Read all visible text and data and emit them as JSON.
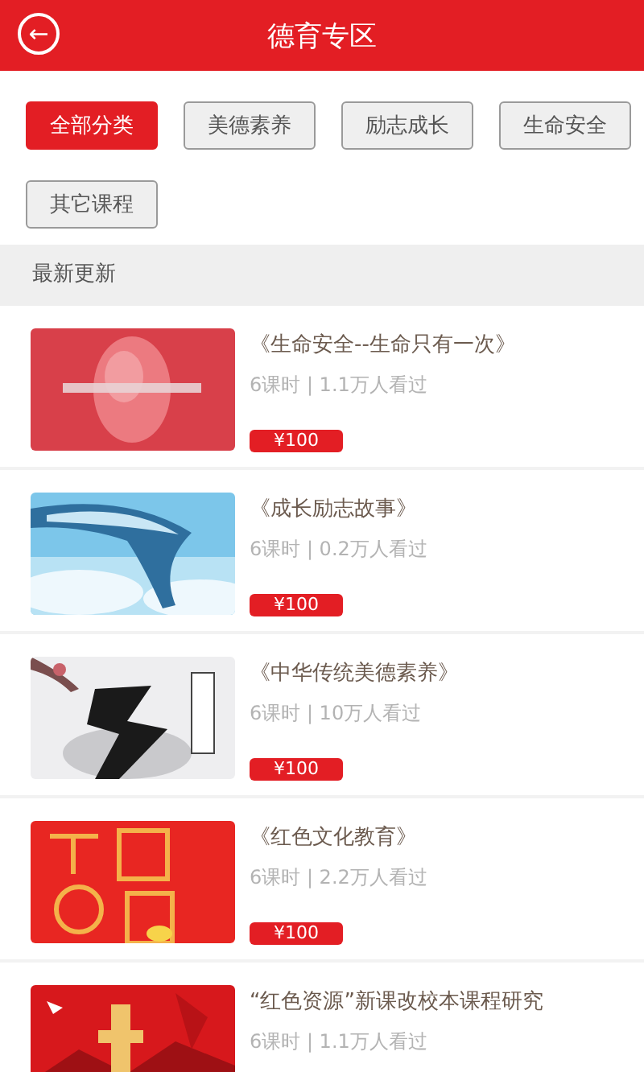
{
  "header": {
    "back": "←",
    "title": "德育专区"
  },
  "filters": [
    {
      "label": "全部分类",
      "selected": true
    },
    {
      "label": "美德素养",
      "selected": false
    },
    {
      "label": "励志成长",
      "selected": false
    },
    {
      "label": "生命安全",
      "selected": false
    },
    {
      "label": "其它课程",
      "selected": false
    }
  ],
  "section": {
    "title": "最新更新"
  },
  "courses": [
    {
      "title": "《生命安全--生命只有一次》",
      "meta": "6课时 | 1.1万人看过",
      "price": "¥100"
    },
    {
      "title": "《成长励志故事》",
      "meta": "6课时 | 0.2万人看过",
      "price": "¥100"
    },
    {
      "title": "《中华传统美德素养》",
      "meta": "6课时 | 10万人看过",
      "price": "¥100"
    },
    {
      "title": "《红色文化教育》",
      "meta": "6课时 | 2.2万人看过",
      "price": "¥100"
    },
    {
      "title": "“红色资源”新课改校本课程研究",
      "meta": "6课时 | 1.1万人看过"
    }
  ]
}
